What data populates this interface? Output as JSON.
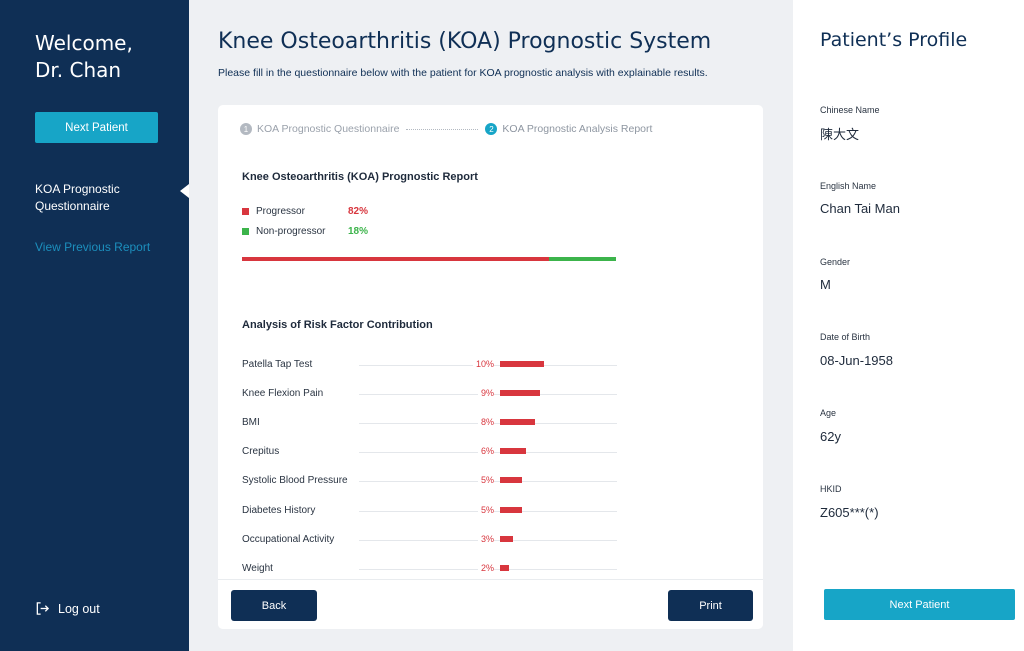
{
  "sidebar": {
    "welcome_line1": "Welcome,",
    "welcome_line2": "Dr. Chan",
    "next_patient_label": "Next Patient",
    "nav_active_label": "KOA Prognostic Questionnaire",
    "nav_previous_label": "View Previous Report",
    "logout_label": "Log out",
    "logout_icon": "logout-icon"
  },
  "main": {
    "title": "Knee Osteoarthritis (KOA) Prognostic System",
    "subtitle": "Please fill in the questionnaire below with the patient for KOA prognostic analysis with explainable results.",
    "steps": [
      {
        "number": "1",
        "label": "KOA Prognostic Questionnaire",
        "state": "completed"
      },
      {
        "number": "2",
        "label": "KOA Prognostic Analysis Report",
        "state": "active"
      }
    ],
    "report_title": "Knee Osteoarthritis (KOA) Prognostic Report",
    "prediction": [
      {
        "label": "Progressor",
        "percent_label": "82%",
        "value": 82,
        "color": "#d8363e"
      },
      {
        "label": "Non-progressor",
        "percent_label": "18%",
        "value": 18,
        "color": "#3cb44b"
      }
    ],
    "risk_title": "Analysis of Risk Factor Contribution",
    "risk_factors": [
      {
        "label": "Patella Tap Test",
        "percent_label": "10%",
        "value": 10
      },
      {
        "label": "Knee Flexion Pain",
        "percent_label": "9%",
        "value": 9
      },
      {
        "label": "BMI",
        "percent_label": "8%",
        "value": 8
      },
      {
        "label": "Crepitus",
        "percent_label": "6%",
        "value": 6
      },
      {
        "label": "Systolic Blood Pressure",
        "percent_label": "5%",
        "value": 5
      },
      {
        "label": "Diabetes History",
        "percent_label": "5%",
        "value": 5
      },
      {
        "label": "Occupational Activity",
        "percent_label": "3%",
        "value": 3
      },
      {
        "label": "Weight",
        "percent_label": "2%",
        "value": 2
      }
    ],
    "back_label": "Back",
    "print_label": "Print"
  },
  "profile": {
    "title": "Patient’s Profile",
    "fields": [
      {
        "label": "Chinese Name",
        "value": "陳大文"
      },
      {
        "label": "English Name",
        "value": "Chan Tai Man"
      },
      {
        "label": "Gender",
        "value": "M"
      },
      {
        "label": "Date of Birth",
        "value": "08-Jun-1958"
      },
      {
        "label": "Age",
        "value": "62y"
      },
      {
        "label": "HKID",
        "value": "Z605***(*)"
      }
    ],
    "next_patient_label": "Next Patient"
  },
  "colors": {
    "navy": "#0f2f55",
    "accent": "#17a5c7",
    "risk_red": "#d8363e",
    "safe_green": "#3cb44b"
  }
}
